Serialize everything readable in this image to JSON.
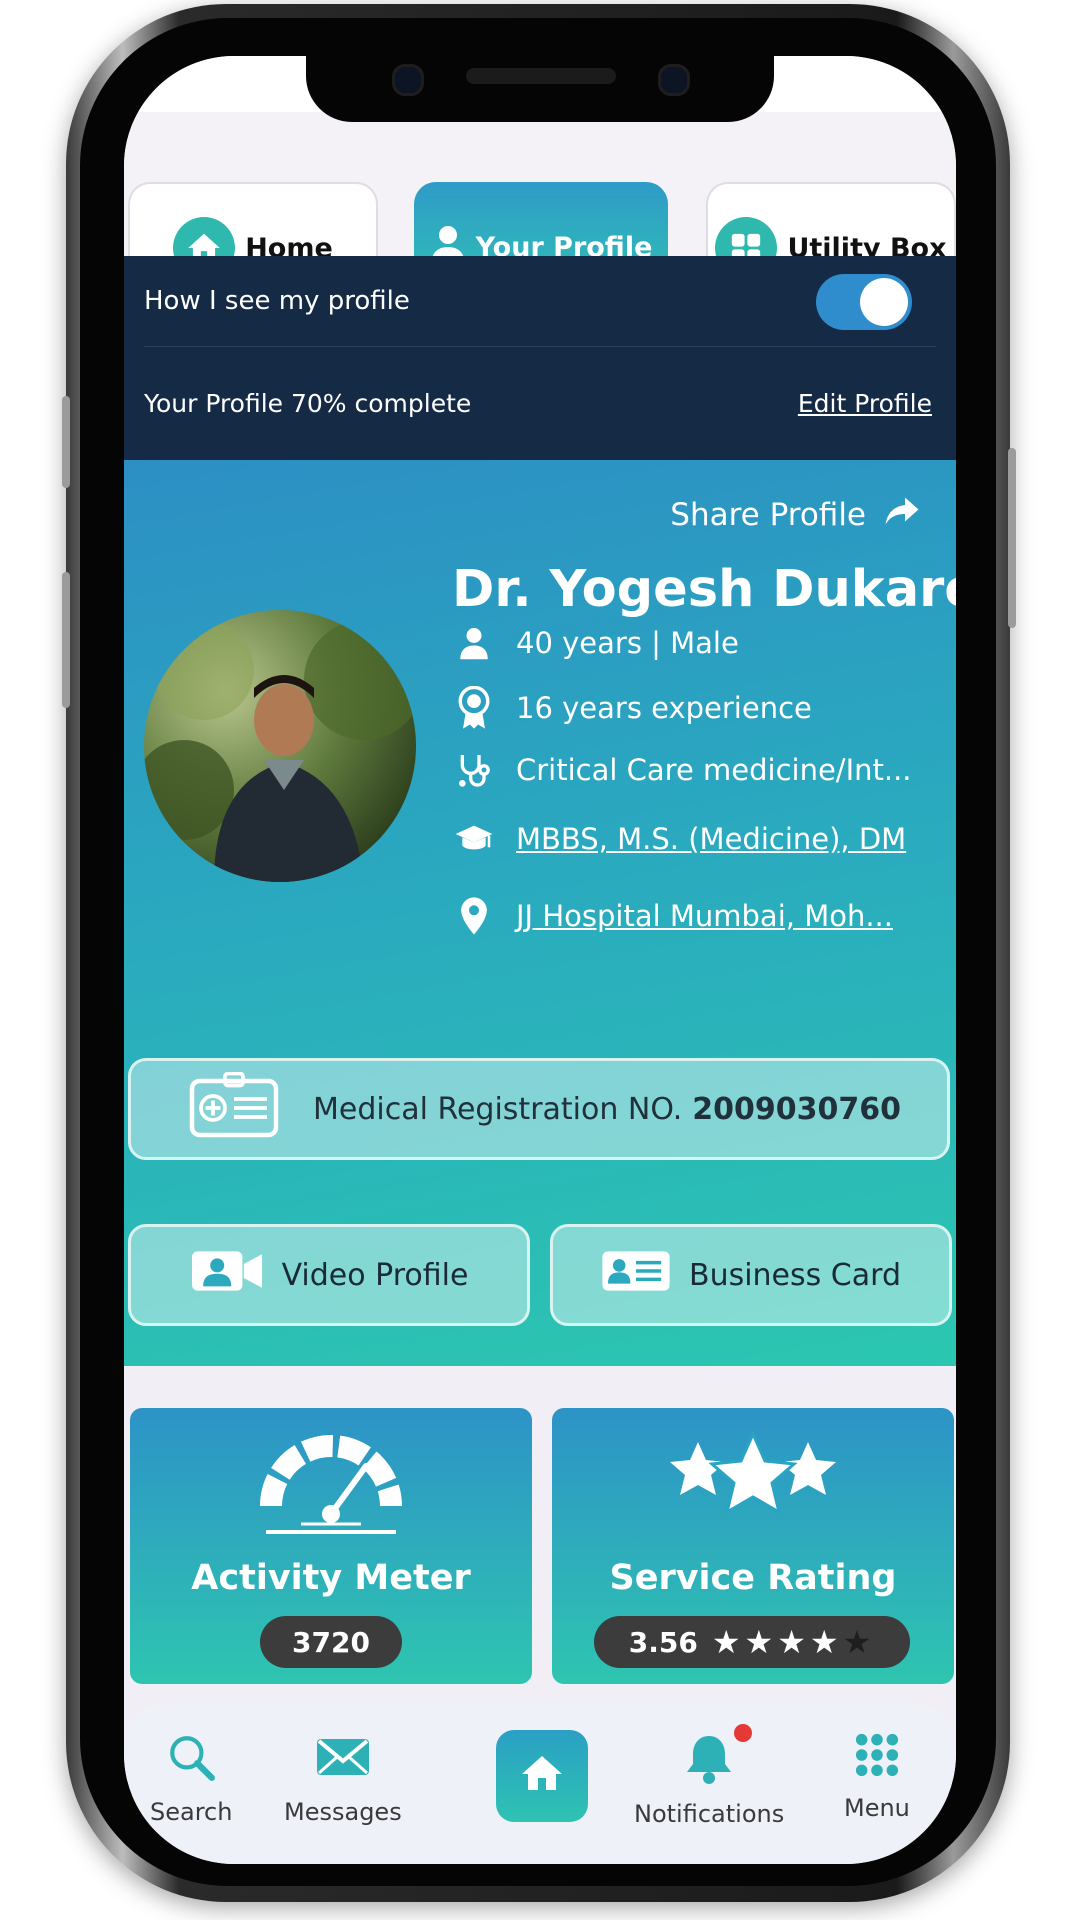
{
  "tabs": [
    {
      "label": "Home",
      "icon": "home-icon",
      "active": false
    },
    {
      "label": "Your Profile",
      "icon": "user-icon",
      "active": true
    },
    {
      "label": "Utility Box",
      "icon": "grid-icon",
      "active": false
    }
  ],
  "profile_view": {
    "toggle_label": "How I see my profile",
    "toggle_on": true,
    "completion_text": "Your Profile 70% complete",
    "edit_label": "Edit Profile"
  },
  "hero": {
    "share_label": "Share Profile",
    "name": "Dr. Yogesh Dukare",
    "age_gender": "40 years | Male",
    "experience": "16 years experience",
    "specialty": "Critical Care medicine/Int...",
    "qualification": "MBBS, M.S. (Medicine), DM",
    "location": "JJ Hospital Mumbai, Moh...",
    "registration_label": "Medical Registration NO.",
    "registration_number": "2009030760",
    "video_profile_label": "Video Profile",
    "business_card_label": "Business Card"
  },
  "stats": {
    "activity": {
      "title": "Activity Meter",
      "value": "3720"
    },
    "rating": {
      "title": "Service Rating",
      "value": "3.56",
      "stars_filled": 4,
      "stars_total": 5
    }
  },
  "bottom_nav": {
    "search": "Search",
    "messages": "Messages",
    "notifications": "Notifications",
    "menu": "Menu"
  },
  "colors": {
    "accent": "#2fb8ae",
    "dark_panel": "#152a45",
    "gradient_top": "#2c8fc4",
    "gradient_bottom": "#2bc7b0"
  }
}
